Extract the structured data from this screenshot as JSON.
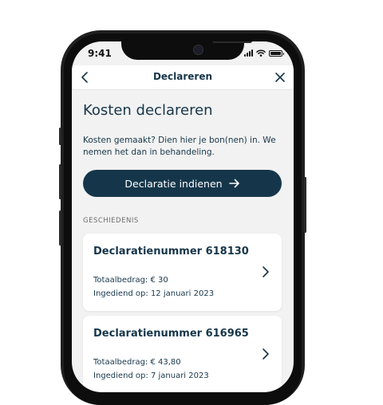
{
  "status_bar": {
    "time": "9:41"
  },
  "nav": {
    "title": "Declareren"
  },
  "page": {
    "title": "Kosten declareren",
    "intro": "Kosten gemaakt? Dien hier je bon(nen) in. We nemen het dan in behandeling.",
    "cta_label": "Declaratie indienen"
  },
  "history": {
    "label": "GESCHIEDENIS",
    "items": [
      {
        "title": "Declaratienummer 618130",
        "amount": "Totaalbedrag: € 30",
        "date": "Ingediend op: 12 januari 2023"
      },
      {
        "title": "Declaratienummer 616965",
        "amount": "Totaalbedrag: € 43,80",
        "date": "Ingediend op: 7 januari 2023"
      }
    ]
  },
  "colors": {
    "primary": "#15364a",
    "background": "#f2f2f2",
    "card": "#ffffff"
  },
  "icons": {
    "back": "chevron-left-icon",
    "close": "close-icon",
    "cta_arrow": "arrow-right-icon",
    "card_chevron": "chevron-right-icon"
  }
}
